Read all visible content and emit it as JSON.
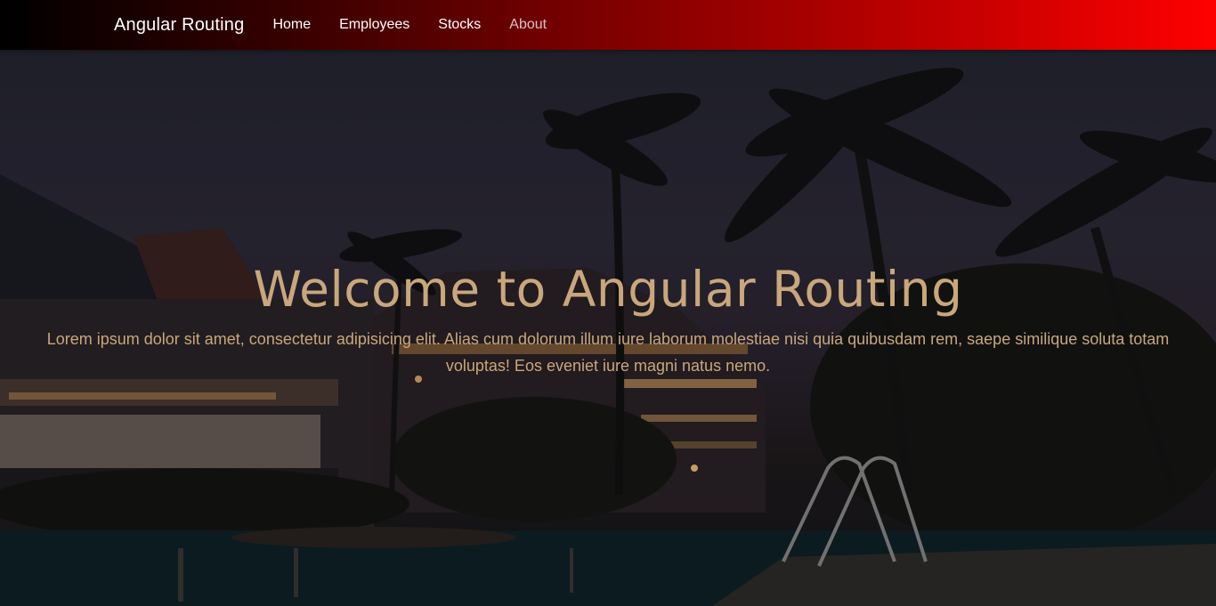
{
  "navbar": {
    "brand": "Angular Routing",
    "links": [
      {
        "label": "Home"
      },
      {
        "label": "Employees"
      },
      {
        "label": "Stocks"
      },
      {
        "label": "About"
      }
    ]
  },
  "hero": {
    "title": "Welcome to Angular Routing",
    "text": "Lorem ipsum dolor sit amet, consectetur adipisicing elit. Alias cum dolorum illum iure laborum molestiae nisi quia quibusdam rem, saepe similique soluta totam voluptas! Eos eveniet iure magni natus nemo.",
    "background_image": "night resort pool with palm trees"
  },
  "colors": {
    "nav_gradient_start": "#000000",
    "nav_gradient_end": "#ff0000",
    "hero_text": "#c9a77c"
  }
}
